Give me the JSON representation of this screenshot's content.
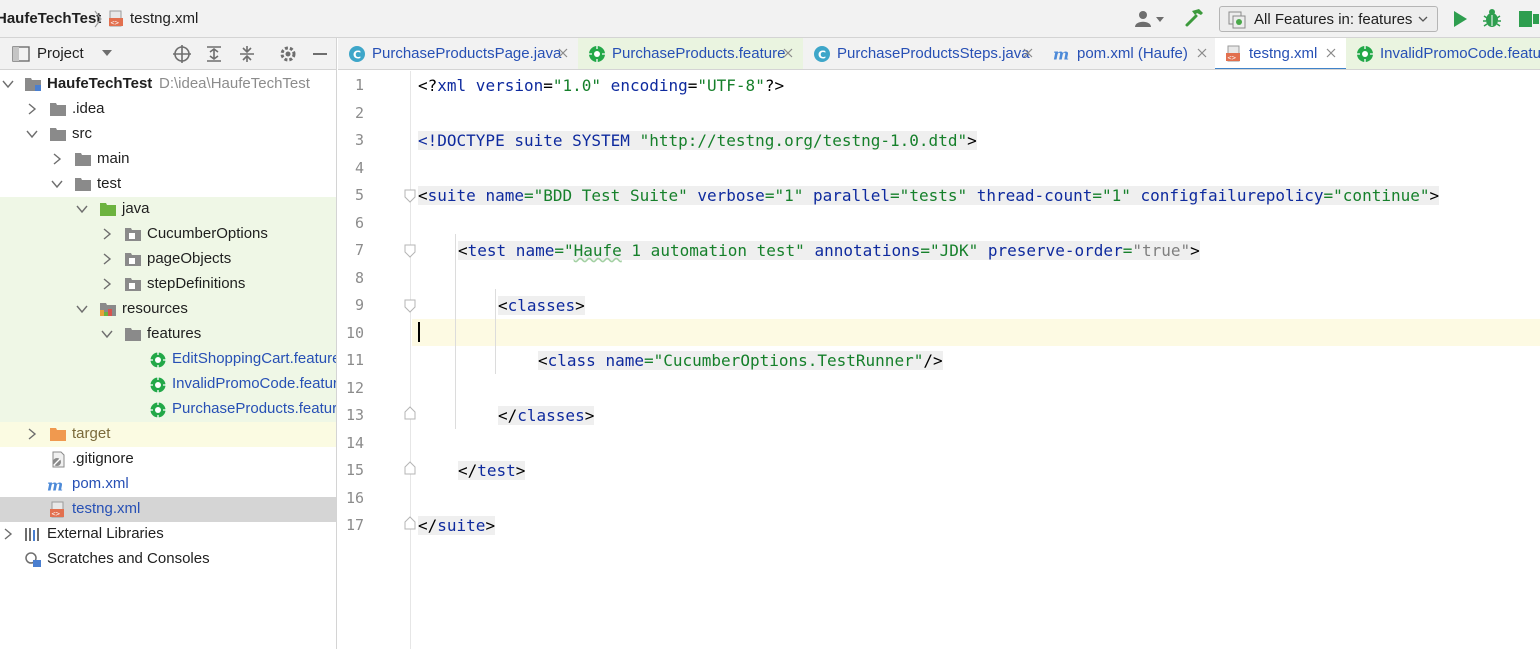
{
  "navbar": {
    "project_name": "HaufeTechTest",
    "file_name": "testng.xml",
    "run_config_label": "All Features in: features"
  },
  "project_panel": {
    "title": "Project",
    "tree": [
      {
        "label": "HaufeTechTest",
        "path": "D:\\idea\\HaufeTechTest"
      },
      {
        "label": ".idea"
      },
      {
        "label": "src"
      },
      {
        "label": "main"
      },
      {
        "label": "test"
      },
      {
        "label": "java"
      },
      {
        "label": "CucumberOptions"
      },
      {
        "label": "pageObjects"
      },
      {
        "label": "stepDefinitions"
      },
      {
        "label": "resources"
      },
      {
        "label": "features"
      },
      {
        "label": "EditShoppingCart.feature"
      },
      {
        "label": "InvalidPromoCode.feature"
      },
      {
        "label": "PurchaseProducts.feature"
      },
      {
        "label": "target"
      },
      {
        "label": ".gitignore"
      },
      {
        "label": "pom.xml"
      },
      {
        "label": "testng.xml"
      },
      {
        "label": "External Libraries"
      },
      {
        "label": "Scratches and Consoles"
      }
    ]
  },
  "tabs": [
    {
      "label": "PurchaseProductsPage.java"
    },
    {
      "label": "PurchaseProducts.feature"
    },
    {
      "label": "PurchaseProductsSteps.java"
    },
    {
      "label": "pom.xml (Haufe)"
    },
    {
      "label": "testng.xml"
    },
    {
      "label": "InvalidPromoCode.feature"
    }
  ],
  "editor": {
    "line_numbers": [
      "1",
      "2",
      "3",
      "4",
      "5",
      "6",
      "7",
      "8",
      "9",
      "10",
      "11",
      "12",
      "13",
      "14",
      "15",
      "16",
      "17"
    ],
    "code": {
      "l1_open": "<?",
      "l1_xml": "xml",
      "l1_a1": " version",
      "l1_eq1": "=",
      "l1_v1": "\"1.0\"",
      "l1_a2": " encoding",
      "l1_eq2": "=",
      "l1_v2": "\"UTF-8\"",
      "l1_close": "?>",
      "l3_open": "<!",
      "l3_doctype": "DOCTYPE",
      "l3_suite": " suite",
      "l3_system": " SYSTEM",
      "l3_url": " \"http://testng.org/testng-1.0.dtd\"",
      "l3_close": ">",
      "l5_open": "<",
      "l5_tag": "suite",
      "l5_a1": " name",
      "l5_v1": "=\"BDD Test Suite\"",
      "l5_a2": " verbose",
      "l5_v2": "=\"1\"",
      "l5_a3": " parallel",
      "l5_v3": "=\"tests\"",
      "l5_a4": " thread-count",
      "l5_v4": "=\"1\"",
      "l5_a5": " configfailurepolicy",
      "l5_v5": "=\"continue\"",
      "l5_close": ">",
      "l7_open": "<",
      "l7_tag": "test",
      "l7_a1": " name",
      "l7_v1a": "=\"",
      "l7_v1b": "Haufe",
      "l7_v1c": " 1 automation test\"",
      "l7_a2": " annotations",
      "l7_v2": "=\"JDK\"",
      "l7_a3": " preserve-order",
      "l7_eq3": "=",
      "l7_v3": "\"true\"",
      "l7_close": ">",
      "l9_open": "<",
      "l9_tag": "classes",
      "l9_close": ">",
      "l11_open": "<",
      "l11_tag": "class",
      "l11_a1": " name",
      "l11_v1": "=\"CucumberOptions.TestRunner\"",
      "l11_close": "/>",
      "l13_open": "</",
      "l13_tag": "classes",
      "l13_close": ">",
      "l15_open": "</",
      "l15_tag": "test",
      "l15_close": ">",
      "l17_open": "</",
      "l17_tag": "suite",
      "l17_close": ">"
    }
  },
  "colors": {
    "accent": "#4083c9",
    "tag": "#0e2a9e",
    "string": "#16802b",
    "green_highlight": "#eff7e6",
    "current_line": "#fdfae3"
  }
}
